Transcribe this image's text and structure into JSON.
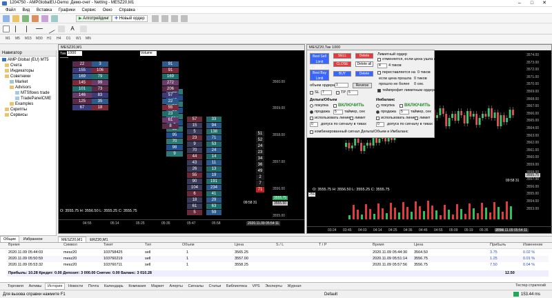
{
  "window": {
    "title": "1204750 - AMPGlobalEU-Demo: Демо-счет - Netting - MESZ20,M1"
  },
  "menu": [
    "Файл",
    "Вид",
    "Вставка",
    "Графики",
    "Сервис",
    "Окно",
    "Справка"
  ],
  "toolbar": {
    "algo_label": "Алготрейдинг",
    "new_order_label": "Новый ордер",
    "period_labels": [
      "M1",
      "M5",
      "M15",
      "M30",
      "H1",
      "H4",
      "D1",
      "W1",
      "MN"
    ]
  },
  "navigator": {
    "title": "Навигатор",
    "items": [
      "AMP Global (EU) MT5",
      "Счета",
      "Индикаторы",
      "Советники",
      "Market",
      "Advisors",
      "MTSflows trade",
      "TradePanelCME",
      "Examples",
      "Скрипты",
      "Сервисы"
    ],
    "tabs": [
      "Общие",
      "Избранное"
    ]
  },
  "chart1": {
    "title": "MESZ20,M1",
    "tick_label": "Тик",
    "tick_value": "1000",
    "volume_select": "Volume",
    "ohlc": "O: 3555.75  H: 3556.50  L: 3555.25  C: 3555.75",
    "prices": [
      "3560.00",
      "3559.00",
      "3558.00",
      "3557.00",
      "3556.00",
      "3555.00"
    ],
    "bid": "3555.50",
    "ask": "3555.75",
    "time_marks": [
      "04:55",
      "05:14",
      "05:25",
      "05:35",
      "05:47",
      "05:58"
    ],
    "timer": "09:58 31",
    "footer_time": "2020.11.09 05:54:11",
    "footprint": [
      [
        "22",
        "3"
      ],
      [
        "155",
        "106"
      ],
      [
        "169",
        "79"
      ],
      [
        "145",
        "99"
      ],
      [
        "101",
        "73"
      ],
      [
        "146",
        "83"
      ],
      [
        "125",
        "35"
      ],
      [
        "67",
        "18"
      ],
      [
        "91",
        "52"
      ],
      [
        "91",
        "79"
      ],
      [
        "169",
        "90"
      ],
      [
        "272",
        "56"
      ],
      [
        "206",
        "104"
      ],
      [
        "57",
        "5"
      ],
      [
        "22",
        "15"
      ],
      [
        "55",
        "95"
      ],
      [
        "23",
        "70"
      ],
      [
        "61",
        "98"
      ],
      [
        "8",
        "9"
      ]
    ],
    "col4": [
      "57",
      "15",
      "5",
      "23",
      "9",
      "70",
      "44",
      "43",
      "26",
      "55",
      "90",
      "104",
      "6",
      "18",
      "61",
      "5"
    ],
    "col5": [
      "33",
      "94",
      "138",
      "71",
      "53",
      "24",
      "14",
      "11",
      "13",
      "19",
      "191",
      "234",
      "41",
      "29",
      "63",
      "59"
    ],
    "right_col": [
      "51",
      "52",
      "24",
      "23",
      "34",
      "36",
      "49",
      "2",
      "7",
      "71"
    ]
  },
  "chart2": {
    "title": "MESZ20,Тик 1000",
    "ohlc": "O: 3555.75  H: 3556.50  L: 3555.25  C: 3555.75",
    "prices": [
      "3574.00",
      "3573.00",
      "3572.00",
      "3571.00",
      "3570.00",
      "3569.00",
      "3568.00",
      "3567.00",
      "3566.00",
      "3565.00",
      "3564.00",
      "3563.00",
      "3562.00",
      "3561.00",
      "3560.00",
      "3559.00",
      "3558.00",
      "3557.00",
      "3556.00",
      "3555.00",
      "3554.00",
      "3553.00"
    ],
    "bid": "3555.75",
    "timer": "09:58 31",
    "footer_time": "2020.11.09 05:54:11",
    "time_marks": [
      "03:24",
      "03:45",
      "04:03",
      "04:14",
      "04:25",
      "04:36",
      "04:45",
      "04:55",
      "05:09",
      "05:19",
      "05:35",
      "05:54"
    ],
    "current_price": "256"
  },
  "panel": {
    "buttons": [
      "Best Sell Limit 3555.2",
      "SELL",
      "Delete",
      "CLOSE",
      "Delete all",
      "Best Buy Limit 3555.5",
      "BUY",
      "Delete"
    ],
    "limit_label": "Лимитный ордер",
    "limit_opts": [
      "отменяется, если цена ушла на",
      "4 тиков",
      "переставляется на",
      "0 тиков",
      "если цена прошла",
      "0 тиков",
      "прошло не более",
      "0 сек.",
      "тейкпрофит лимитным ордером"
    ],
    "volume_label": "объем ордера",
    "volume_value": "1",
    "reverse_label": "Reverse",
    "sl_label": "SL",
    "sl_value": "7",
    "tp_label": "TP",
    "tp_value": "5",
    "left_title": "Дельта/Объем",
    "right_title": "Имбаланс",
    "buy_label": "покупка",
    "sell_label": "продажа",
    "enable_label": "ВКЛЮЧИТЬ",
    "timer_label": "таймер, сек",
    "timer_value": "5",
    "line_label": "использовать линию",
    "limit_chk": "лимит",
    "signal_label": "допуск по сигналу в тиках",
    "combined_label": "комбинированный сигнал Дельта/Объем и Имбаланс",
    "zero": "0"
  },
  "chart_tabs": [
    "MESZ20,M1",
    "ERZ20,M1"
  ],
  "history": {
    "headers": [
      "Время",
      "Символ",
      "Тикет",
      "Тип",
      "Объем",
      "Цена",
      "S / L",
      "T / P",
      "Время",
      "Цена",
      "Прибыль",
      "Изменение"
    ],
    "rows": [
      [
        "2020.11.09 05:44:03",
        "mesz20",
        "103758425",
        "sell",
        "1",
        "3565.25",
        "",
        "",
        "2020.11.09 05:44:30",
        "3564.50",
        "3.75",
        "0.02 %"
      ],
      [
        "2020.11.09 05:50:59",
        "mesz20",
        "103760219",
        "sell",
        "1",
        "3557.00",
        "",
        "",
        "2020.11.09 05:51:14",
        "3556.75",
        "1.25",
        "0.01 %"
      ],
      [
        "2020.11.09 05:53:32",
        "mesz20",
        "103760711",
        "sell",
        "1",
        "3558.25",
        "",
        "",
        "2020.11.09 05:57:56",
        "3556.75",
        "7.50",
        "0.04 %"
      ]
    ],
    "summary": "Прибыль: 10.28  Кредит: 0.00  Депозит: 3 000.00  Снятие: 0.00  Баланс: 3 010.28",
    "summary_total": "12.50"
  },
  "bottom_tabs": [
    "Торговля",
    "Активы",
    "История",
    "Новости",
    "Почта",
    "Календарь",
    "Компания",
    "Маркет",
    "Алерты",
    "Сигналы",
    "Статьи",
    "Библиотека",
    "VPS",
    "Эксперты",
    "Журнал"
  ],
  "tester_label": "Тестер стратегий",
  "status": {
    "help": "Для вызова справки нажмите F1",
    "profile": "Default",
    "net": "153.44 ms"
  },
  "colors": {
    "buy_blue": "#3a66ff",
    "sell_red": "#e23b3b",
    "bid_green": "#26a65b",
    "bg": "#000000"
  }
}
